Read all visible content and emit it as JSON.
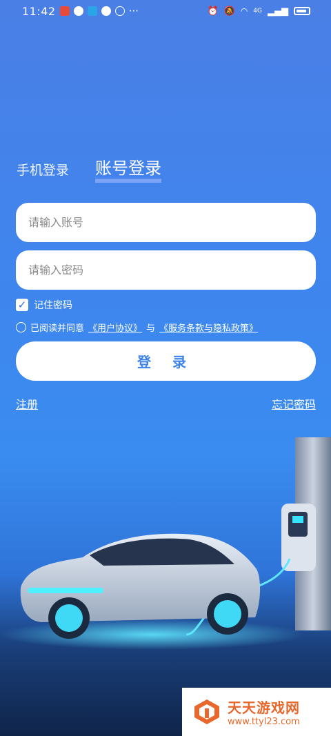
{
  "status_bar": {
    "time": "11:42",
    "dots": "···",
    "signal": "4G"
  },
  "tabs": [
    {
      "label": "手机登录",
      "active": false
    },
    {
      "label": "账号登录",
      "active": true
    }
  ],
  "account_field": {
    "placeholder": "请输入账号",
    "value": ""
  },
  "password_field": {
    "placeholder": "请输入密码",
    "value": ""
  },
  "remember": {
    "label": "记住密码",
    "checked": true,
    "check_glyph": "✓"
  },
  "agreement": {
    "prefix": "已阅读并同意",
    "user_agreement": "《用户协议》",
    "conjunction": "与",
    "privacy_policy": "《服务条款与隐私政策》"
  },
  "login_button": {
    "label": "登 录"
  },
  "register_link": "注册",
  "forgot_link": "忘记密码",
  "watermark": {
    "title": "天天游戏网",
    "url": "www.ttyl23.com"
  },
  "colors": {
    "accent": "#3d83ea",
    "watermark": "#e8672c"
  }
}
